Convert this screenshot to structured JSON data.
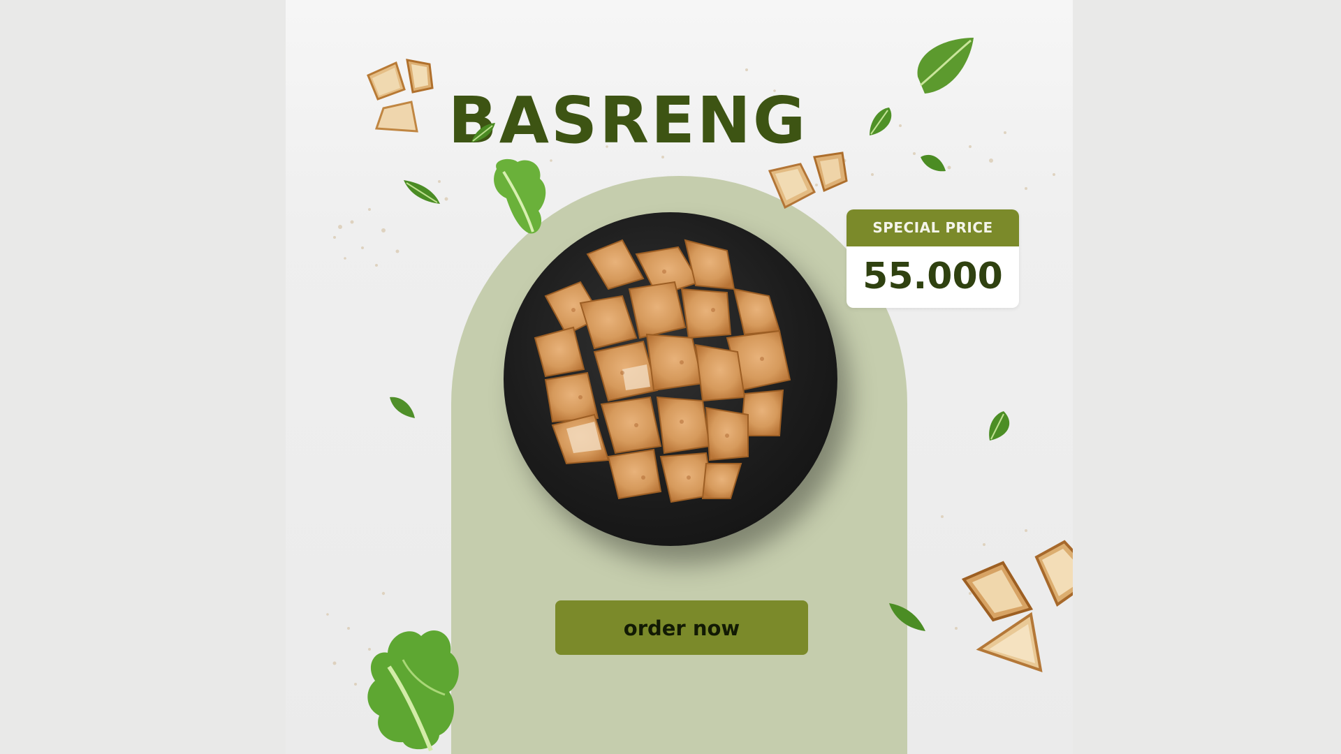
{
  "poster": {
    "title": "BASRENG",
    "price_label": "SPECIAL PRICE",
    "price_value": "55.000",
    "cta_label": "order now"
  },
  "colors": {
    "background": "#e9e9e8",
    "arch": "#c5cdad",
    "accent_green": "#7b8a2a",
    "title_green": "#3d5413",
    "price_text": "#2f4110",
    "plate": "#1c1c1c"
  },
  "icons": [
    "crouton-icon",
    "lettuce-leaf-icon",
    "chips-icon",
    "plate-icon"
  ]
}
